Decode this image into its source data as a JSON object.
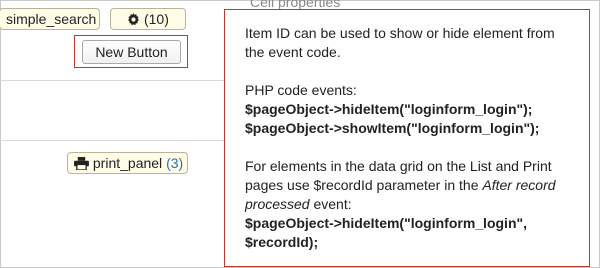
{
  "toolbar": {
    "simple_search_label": "simple_search",
    "gear_count": "(10)",
    "new_button_label": "New Button",
    "print_panel_label": "print_panel",
    "print_panel_count": "(3)"
  },
  "background": {
    "partial_heading": "Cell properties"
  },
  "tooltip": {
    "intro": "Item ID can be used to show or hide element from the event code.",
    "php_heading": "PHP code events:",
    "php_line1": "$pageObject->hideItem(\"loginform_login\");",
    "php_line2": "$pageObject->showItem(\"loginform_login\");",
    "list_text_before": "For elements in the data grid on the List and Print pages use $recordId parameter in the ",
    "list_text_italic": "After record processed",
    "list_text_after": " event:",
    "code_line1": "$pageObject->hideItem(\"loginform_login\",",
    "code_line2": "$recordId);"
  },
  "colors": {
    "chip_bg": "#fffde8",
    "highlight_border": "#c0392b",
    "count_blue": "#2a6fb3"
  },
  "icons": [
    "gear-icon",
    "printer-icon"
  ]
}
